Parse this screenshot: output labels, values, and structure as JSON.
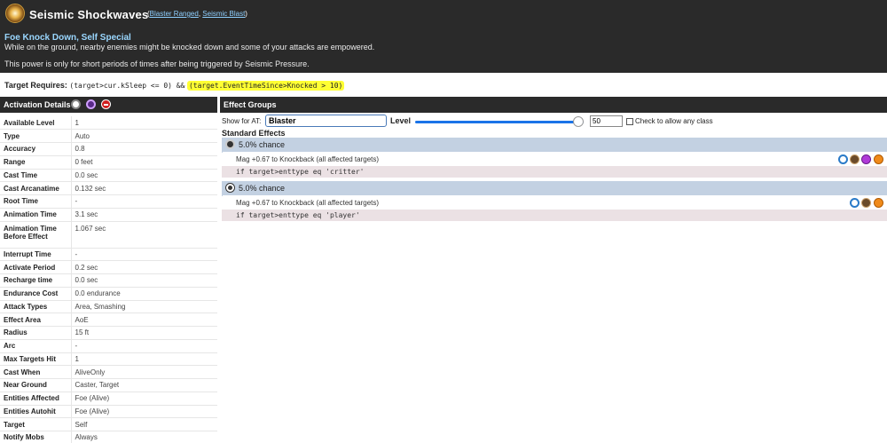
{
  "header": {
    "title": "Seismic Shockwaves",
    "links": [
      "Blaster Ranged",
      "Seismic Blast"
    ],
    "subtitle": "Foe Knock Down, Self Special",
    "description": "While on the ground, nearby enemies might be knocked down and some of your attacks are empowered.",
    "note": "This power is only for short periods of times after being triggered by Seismic Pressure."
  },
  "requires": {
    "label": "Target Requires:",
    "expr": "(target>cur.kSleep <= 0) &&",
    "highlight": "(target.EventTimeSince>Knocked > 10)"
  },
  "activation": {
    "title": "Activation Details",
    "rows": [
      {
        "k": "Available Level",
        "v": "1"
      },
      {
        "k": "Type",
        "v": "Auto"
      },
      {
        "k": "Accuracy",
        "v": "0.8"
      },
      {
        "k": "Range",
        "v": "0 feet"
      },
      {
        "k": "Cast Time",
        "v": "0.0 sec"
      },
      {
        "k": "Cast Arcanatime",
        "v": "0.132 sec"
      },
      {
        "k": "Root Time",
        "v": "-"
      },
      {
        "k": "Animation Time",
        "v": "3.1 sec"
      },
      {
        "k": "Animation Time Before Effect",
        "v": "1.067 sec"
      },
      {
        "k": "Interrupt Time",
        "v": "-"
      },
      {
        "k": "Activate Period",
        "v": "0.2 sec"
      },
      {
        "k": "Recharge time",
        "v": "0.0 sec"
      },
      {
        "k": "Endurance Cost",
        "v": "0.0 endurance"
      },
      {
        "k": "Attack Types",
        "v": "Area, Smashing"
      },
      {
        "k": "Effect Area",
        "v": "AoE"
      },
      {
        "k": "Radius",
        "v": "15 ft"
      },
      {
        "k": "Arc",
        "v": "-"
      },
      {
        "k": "Max Targets Hit",
        "v": "1"
      },
      {
        "k": "Cast When",
        "v": "AliveOnly"
      },
      {
        "k": "Near Ground",
        "v": "Caster, Target"
      },
      {
        "k": "Entities Affected",
        "v": "Foe (Alive)"
      },
      {
        "k": "Entities Autohit",
        "v": "Foe (Alive)"
      },
      {
        "k": "Target",
        "v": "Self"
      },
      {
        "k": "Notify Mobs",
        "v": "Always"
      }
    ]
  },
  "effects": {
    "title": "Effect Groups",
    "show_for_label": "Show for AT:",
    "at_value": "Blaster",
    "level_label": "Level",
    "level_value": "50",
    "level_fraction": 1.0,
    "allow_label": "Check to allow any class",
    "standard_title": "Standard Effects",
    "groups": [
      {
        "chance": "5.0% chance",
        "icon": "globe-icon",
        "effect": "Mag +0.67 to Knockback (all affected targets)",
        "cond": "if target>enttype eq 'critter'"
      },
      {
        "chance": "5.0% chance",
        "icon": "player-icon",
        "effect": "Mag +0.67 to Knockback (all affected targets)",
        "cond": "if target>enttype eq 'player'"
      }
    ]
  }
}
